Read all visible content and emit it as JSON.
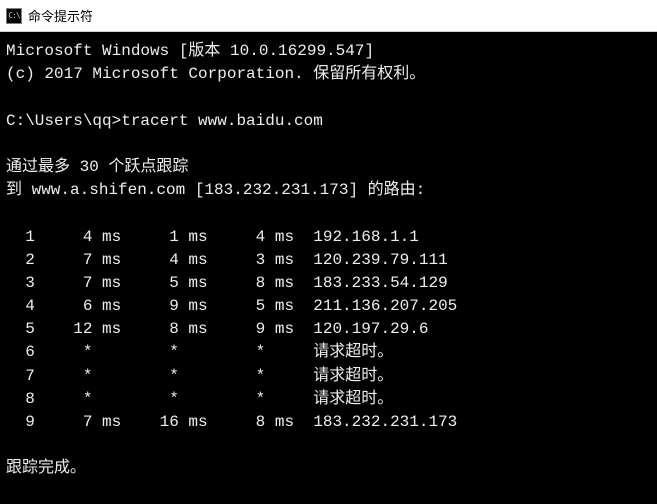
{
  "window": {
    "title": "命令提示符"
  },
  "terminal": {
    "banner_line1": "Microsoft Windows [版本 10.0.16299.547]",
    "banner_line2": "(c) 2017 Microsoft Corporation. 保留所有权利。",
    "prompt": "C:\\Users\\qq>",
    "command": "tracert www.baidu.com",
    "trace_header1": "通过最多 30 个跃点跟踪",
    "trace_header2": "到 www.a.shifen.com [183.232.231.173] 的路由:",
    "hops": [
      {
        "n": "1",
        "t1": "4 ms",
        "t2": "1 ms",
        "t3": "4 ms",
        "host": "192.168.1.1"
      },
      {
        "n": "2",
        "t1": "7 ms",
        "t2": "4 ms",
        "t3": "3 ms",
        "host": "120.239.79.111"
      },
      {
        "n": "3",
        "t1": "7 ms",
        "t2": "5 ms",
        "t3": "8 ms",
        "host": "183.233.54.129"
      },
      {
        "n": "4",
        "t1": "6 ms",
        "t2": "9 ms",
        "t3": "5 ms",
        "host": "211.136.207.205"
      },
      {
        "n": "5",
        "t1": "12 ms",
        "t2": "8 ms",
        "t3": "9 ms",
        "host": "120.197.29.6"
      },
      {
        "n": "6",
        "t1": "*",
        "t2": "*",
        "t3": "*",
        "host": "请求超时。"
      },
      {
        "n": "7",
        "t1": "*",
        "t2": "*",
        "t3": "*",
        "host": "请求超时。"
      },
      {
        "n": "8",
        "t1": "*",
        "t2": "*",
        "t3": "*",
        "host": "请求超时。"
      },
      {
        "n": "9",
        "t1": "7 ms",
        "t2": "16 ms",
        "t3": "8 ms",
        "host": "183.232.231.173"
      }
    ],
    "trace_footer": "跟踪完成。"
  }
}
